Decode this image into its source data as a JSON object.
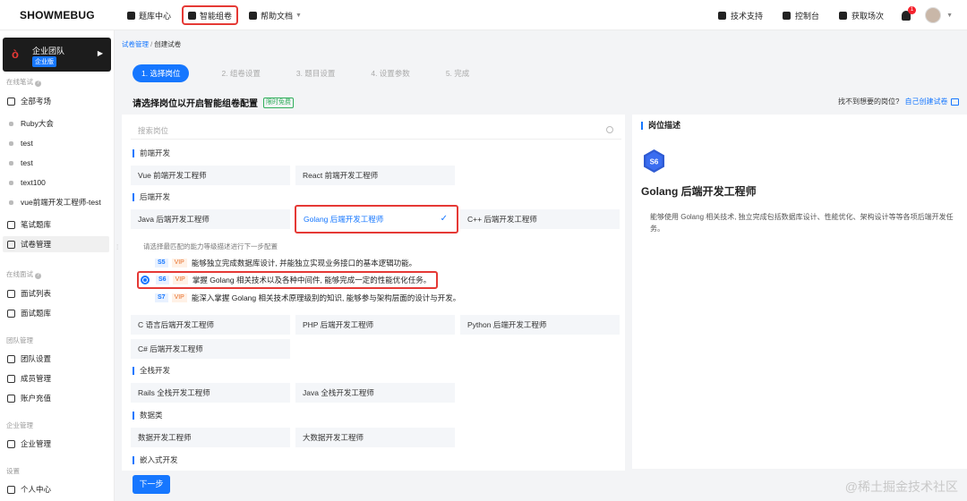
{
  "brand": {
    "logo": "SHOWMEBUG"
  },
  "topnav": {
    "items": [
      {
        "label": "题库中心",
        "icon": "book-icon"
      },
      {
        "label": "智能组卷",
        "icon": "layers-icon"
      },
      {
        "label": "帮助文档",
        "icon": "doc-icon"
      }
    ],
    "right": {
      "support": "技术支持",
      "console": "控制台",
      "credits": "获取场次",
      "notify_count": "1"
    }
  },
  "sidebar": {
    "org": {
      "name": "企业团队",
      "badge": "企业版"
    },
    "groups": {
      "written": "在线笔试",
      "interview": "在线面试",
      "team": "团队管理",
      "enterprise": "企业管理",
      "settings": "设置"
    },
    "items": {
      "all_exams": "全部考场",
      "ruby": "Ruby大会",
      "test1": "test",
      "test2": "test",
      "text100": "text100",
      "vue_test": "vue前端开发工程师-test",
      "written_bank": "笔试题库",
      "paper_mgmt": "试卷管理",
      "interview_list": "面试列表",
      "interview_bank": "面试题库",
      "team_settings": "团队设置",
      "members": "成员管理",
      "recharge": "账户充值",
      "enterprise_mgmt": "企业管理",
      "personal": "个人中心"
    }
  },
  "breadcrumb": {
    "parent": "试卷管理",
    "sep": "/",
    "current": "创建试卷"
  },
  "steps": [
    "1. 选择岗位",
    "2. 组卷设置",
    "3. 题目设置",
    "4. 设置参数",
    "5. 完成"
  ],
  "main": {
    "heading": "请选择岗位以开启智能组卷配置",
    "free_tag": "限时免费",
    "right_hint": "找不到想要的岗位?",
    "right_link": "自己创建试卷",
    "search_placeholder": "搜索岗位",
    "categories": {
      "frontend": "前端开发",
      "backend": "后端开发",
      "fullstack": "全栈开发",
      "data": "数据类",
      "embedded": "嵌入式开发"
    },
    "jobs": {
      "vue": "Vue 前端开发工程师",
      "react": "React 前端开发工程师",
      "java": "Java 后端开发工程师",
      "golang": "Golang 后端开发工程师",
      "cpp": "C++ 后端开发工程师",
      "c": "C 语言后端开发工程师",
      "php": "PHP 后端开发工程师",
      "python": "Python 后端开发工程师",
      "csharp": "C# 后端开发工程师",
      "rails": "Rails 全栈开发工程师",
      "java_full": "Java 全栈开发工程师",
      "data_eng": "数据开发工程师",
      "bigdata": "大数据开发工程师"
    },
    "level_hint": "请选择最匹配的能力等级描述进行下一步配置",
    "levels": [
      {
        "level": "S5",
        "vip": "VIP",
        "text": "能够独立完成数据库设计, 并能独立实现业务接口的基本逻辑功能。"
      },
      {
        "level": "S6",
        "vip": "VIP",
        "text": "掌握 Golang 相关技术以及各种中间件, 能够完成一定的性能优化任务。"
      },
      {
        "level": "S7",
        "vip": "VIP",
        "text": "能深入掌握 Golang 相关技术原理级别的知识, 能够参与架构层面的设计与开发。"
      }
    ],
    "next_button": "下一步"
  },
  "description": {
    "title": "岗位描述",
    "level": "S6",
    "job": "Golang 后端开发工程师",
    "text": "能够使用 Golang 相关技术, 独立完成包括数据库设计、性能优化、架构设计等等各项后端开发任务。"
  },
  "watermark": "@稀土掘金技术社区",
  "colors": {
    "accent": "#1677ff",
    "highlight": "#e53935",
    "vip": "#e8702b",
    "free": "#2fae5b"
  }
}
